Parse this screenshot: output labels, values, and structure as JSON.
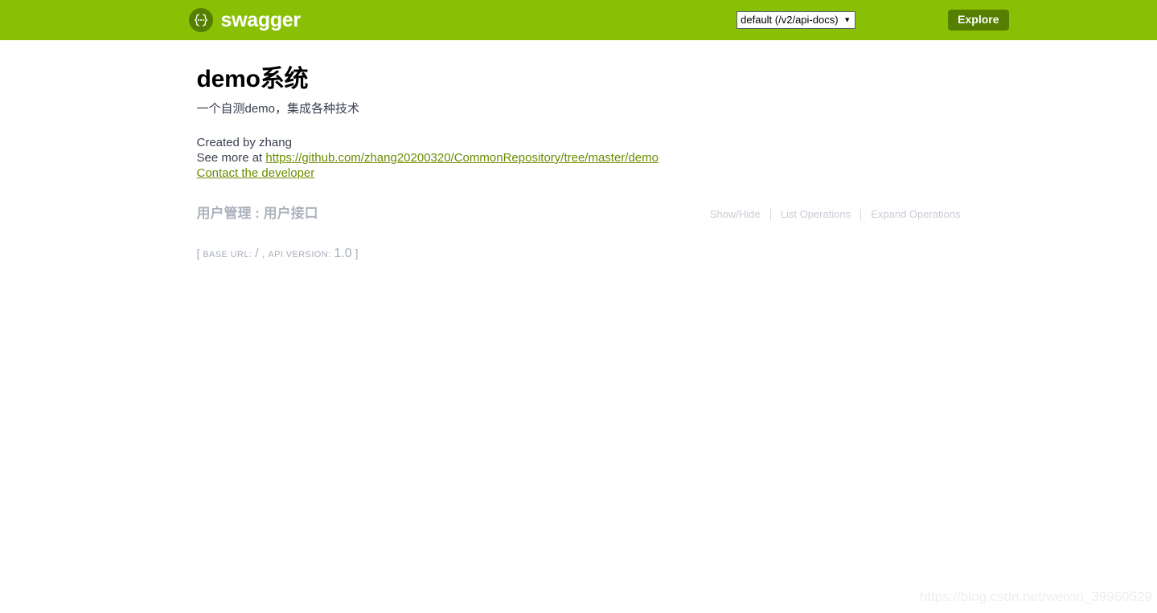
{
  "header": {
    "logo_icon": "swagger-braces-icon",
    "logo_text": "swagger",
    "selected_spec": "default (/v2/api-docs)",
    "spec_options": [
      "default (/v2/api-docs)"
    ],
    "caret_icon": "chevron-down-icon",
    "explore_label": "Explore",
    "bar_color": "#89bf04",
    "accent_color": "#547f00"
  },
  "info": {
    "title": "demo系统",
    "description": "一个自测demo，集成各种技术",
    "created_by": "Created by zhang",
    "see_more_prefix": "See more at ",
    "see_more_url": "https://github.com/zhang20200320/CommonRepository/tree/master/demo",
    "contact_label": "Contact the developer",
    "link_color": "#6c8c00"
  },
  "resources": [
    {
      "heading": "用户管理 : 用户接口",
      "options": {
        "show_hide": "Show/Hide",
        "list_operations": "List Operations",
        "expand_operations": "Expand Operations"
      }
    }
  ],
  "footer": {
    "open_bracket": "[",
    "base_url_label": "BASE URL:",
    "base_url_value": "/",
    "comma": ",",
    "api_version_label": "API VERSION:",
    "api_version_value": "1.0",
    "close_bracket": "]"
  },
  "watermark": {
    "text": "https://blog.csdn.net/weixin_39960529"
  }
}
